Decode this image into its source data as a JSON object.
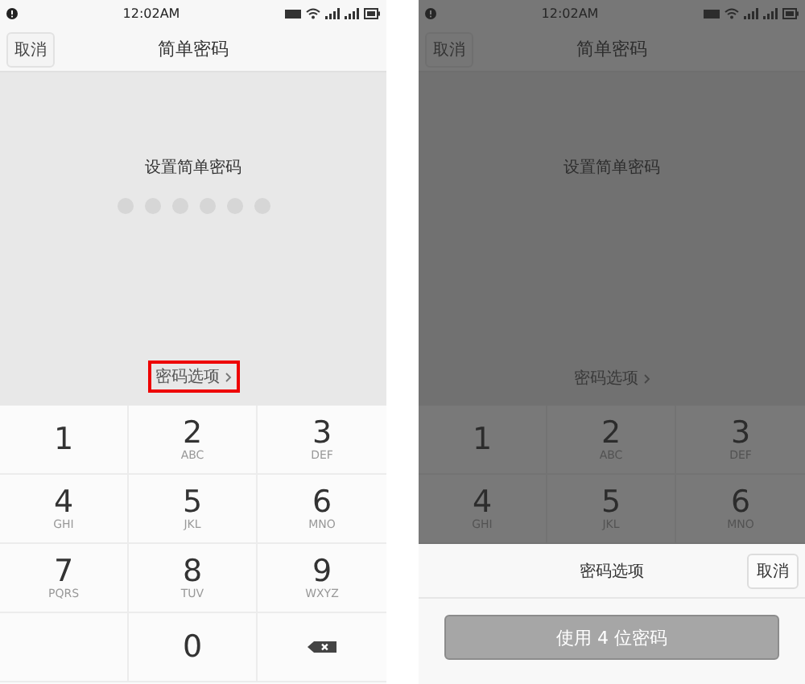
{
  "screens": [
    {
      "dimmed": false,
      "status_bar": {
        "time": "12:02AM"
      },
      "nav": {
        "cancel": "取消",
        "title": "简单密码"
      },
      "prompt": "设置简单密码",
      "pin_dots": [
        {
          "filled": false
        },
        {
          "filled": false
        },
        {
          "filled": false
        },
        {
          "filled": false
        },
        {
          "filled": false
        },
        {
          "filled": false
        }
      ],
      "options_link": {
        "label": "密码选项",
        "highlighted": true
      },
      "keys": [
        {
          "kind": "digit",
          "digit": "1"
        },
        {
          "kind": "digit",
          "digit": "2",
          "letters": "ABC"
        },
        {
          "kind": "digit",
          "digit": "3",
          "letters": "DEF"
        },
        {
          "kind": "digit",
          "digit": "4",
          "letters": "GHI"
        },
        {
          "kind": "digit",
          "digit": "5",
          "letters": "JKL"
        },
        {
          "kind": "digit",
          "digit": "6",
          "letters": "MNO"
        },
        {
          "kind": "digit",
          "digit": "7",
          "letters": "PQRS"
        },
        {
          "kind": "digit",
          "digit": "8",
          "letters": "TUV"
        },
        {
          "kind": "digit",
          "digit": "9",
          "letters": "WXYZ"
        },
        {
          "kind": "blank"
        },
        {
          "kind": "digit",
          "digit": "0"
        },
        {
          "kind": "backspace"
        }
      ]
    },
    {
      "dimmed": true,
      "status_bar": {
        "time": "12:02AM"
      },
      "nav": {
        "cancel": "取消",
        "title": "简单密码"
      },
      "prompt": "设置简单密码",
      "options_link": {
        "label": "密码选项",
        "highlighted": false
      },
      "keys": [
        {
          "kind": "digit",
          "digit": "1"
        },
        {
          "kind": "digit",
          "digit": "2",
          "letters": "ABC"
        },
        {
          "kind": "digit",
          "digit": "3",
          "letters": "DEF"
        },
        {
          "kind": "digit",
          "digit": "4",
          "letters": "GHI"
        },
        {
          "kind": "digit",
          "digit": "5",
          "letters": "JKL"
        },
        {
          "kind": "digit",
          "digit": "6",
          "letters": "MNO"
        }
      ],
      "sheet": {
        "title": "密码选项",
        "cancel": "取消",
        "action": "使用 4 位密码"
      }
    }
  ]
}
